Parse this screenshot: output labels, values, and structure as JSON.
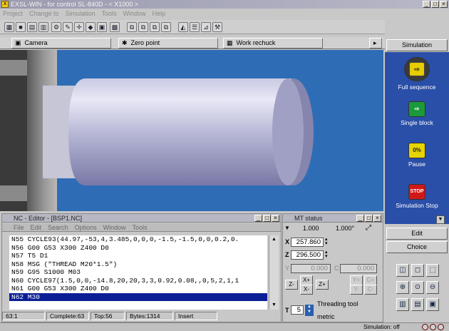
{
  "window": {
    "title": "EXSL-WIN - for control SL-840D - < X1000 >",
    "app_icon": "X"
  },
  "menu": [
    "Project",
    "Change to",
    "Simulation",
    "Tools",
    "Window",
    "Help"
  ],
  "tabs": [
    {
      "label": "Camera",
      "icon": "camera-icon"
    },
    {
      "label": "Zero point",
      "icon": "zero-point-icon"
    },
    {
      "label": "Work rechuck",
      "icon": "rechuck-icon"
    }
  ],
  "nc_editor": {
    "title": "NC - Editor - [BSP1.NC]",
    "menu": [
      "File",
      "Edit",
      "Search",
      "Options",
      "Window",
      "Tools"
    ],
    "lines": [
      "N55 CYCLE93(44.97,-53,4,3.485,0,0,0,-1.5,-1.5,0,0,0.2,0.",
      "N56 G00 G53 X300 Z400 D0",
      "N57 T5 D1",
      "N58 MSG (\"THREAD M20*1.5\")",
      "N59 G95 S1000 M03",
      "N60 CYCLE97(1.5,0,0,-14.8,20,20,3,3,0.92,0.08,,0,5,2,1,1",
      "N61 G00 G53 X300 Z400 D0",
      "N62 M30"
    ],
    "selected_index": 7,
    "status": {
      "position": "63:1",
      "complete": "Complete:63",
      "top": "Top:56",
      "bytes": "Bytes:1314",
      "mode": "Insert"
    }
  },
  "mt_status": {
    "title": "MT status",
    "factor1": "1.000",
    "factor2": "1.000°",
    "x_label": "X",
    "x_value": "257.860",
    "z_label": "Z",
    "z_value": "296.500",
    "y_label": "Y",
    "y_value": "0.000",
    "c_label": "C",
    "c_value": "0.000",
    "buttons": {
      "z_minus": "Z-",
      "x_plus": "X+",
      "x_minus": "X-",
      "z_plus": "Z+",
      "y_plus": "Y+",
      "c_plus": "C+",
      "y_minus": "Y-",
      "c_minus": "C-"
    },
    "tool_label": "T",
    "tool_number": "5",
    "tool_name": "Threading tool",
    "tool_type": "metric"
  },
  "simulation_panel": {
    "header": "Simulation",
    "buttons": [
      {
        "label": "Full sequence",
        "icon": "full-sequence-icon",
        "color": "#e6cc00"
      },
      {
        "label": "Single block",
        "icon": "single-block-icon",
        "color": "#1a9a3a"
      },
      {
        "label": "Pause",
        "icon": "pause-icon",
        "color": "#e6d400",
        "glyph": "0%"
      },
      {
        "label": "Simulation Stop",
        "icon": "stop-icon",
        "color": "#d01818",
        "glyph": "STOP"
      }
    ],
    "edit_header": "Edit",
    "choice_header": "Choice"
  },
  "bottom_status": {
    "text": "Simulation: off"
  },
  "colors": {
    "viewport_bg": "#2e6db5",
    "selection": "#0a1f96"
  }
}
